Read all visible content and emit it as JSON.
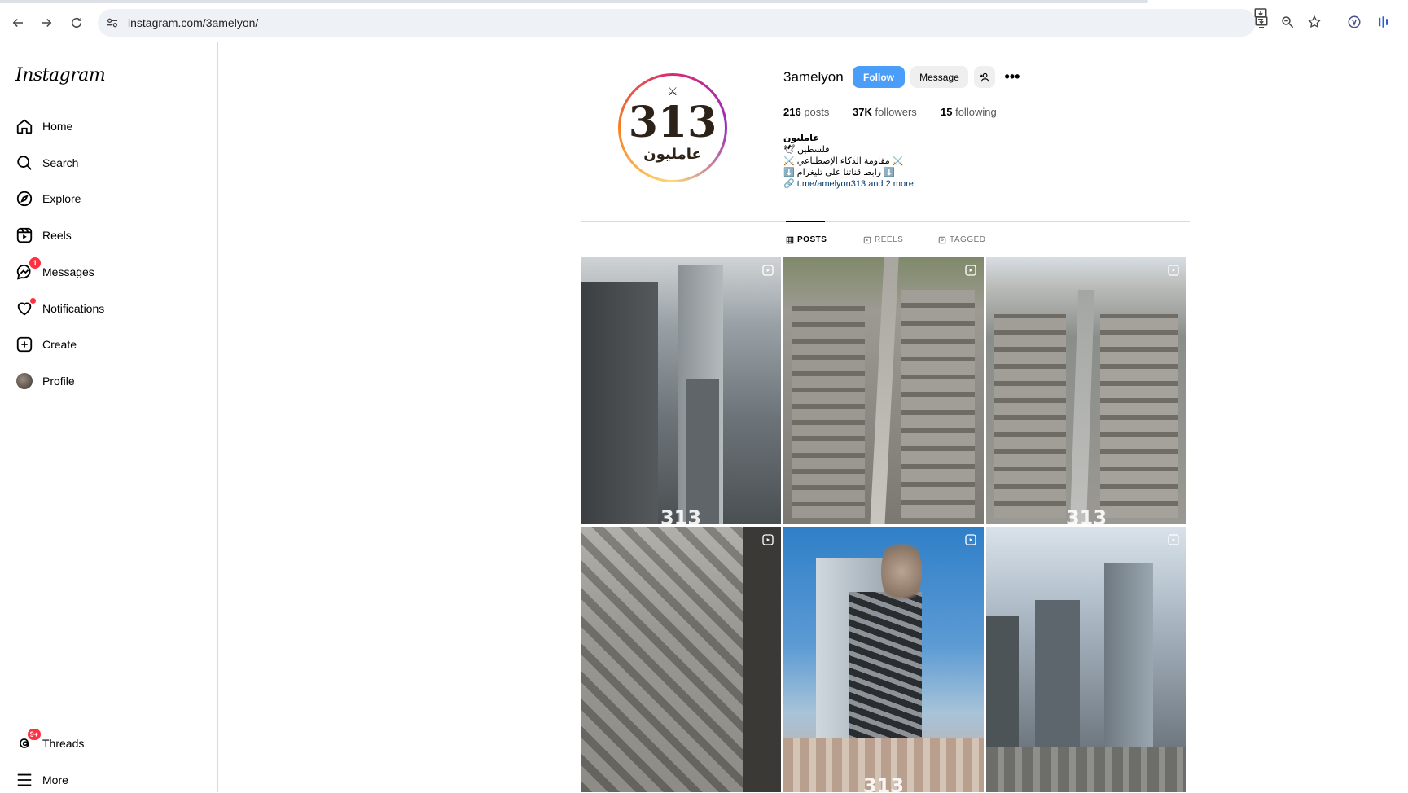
{
  "browser": {
    "url": "instagram.com/3amelyon/"
  },
  "sidebar": {
    "logo": "Instagram",
    "items": [
      {
        "label": "Home"
      },
      {
        "label": "Search"
      },
      {
        "label": "Explore"
      },
      {
        "label": "Reels"
      },
      {
        "label": "Messages",
        "badge": "1"
      },
      {
        "label": "Notifications"
      },
      {
        "label": "Create"
      },
      {
        "label": "Profile"
      }
    ],
    "bottom": [
      {
        "label": "Threads",
        "badge": "9+"
      },
      {
        "label": "More"
      }
    ]
  },
  "profile": {
    "avatar_number": "313",
    "avatar_arabic": "عامليون",
    "username": "3amelyon",
    "follow_label": "Follow",
    "message_label": "Message",
    "stats": {
      "posts_count": "216",
      "posts_label": "posts",
      "followers_count": "37K",
      "followers_label": "followers",
      "following_count": "15",
      "following_label": "following"
    },
    "bio": {
      "name": "عامليون",
      "line1": "🕊 فلسطين",
      "line2": "⚔️ مقاومة الذكاء الإصطناعي ⚔️",
      "line3": "⬇️ رابط قناتنا على تليغرام ⬇️",
      "link": "t.me/amelyon313 and 2 more"
    }
  },
  "tabs": [
    {
      "label": "POSTS",
      "active": true
    },
    {
      "label": "REELS",
      "active": false
    },
    {
      "label": "TAGGED",
      "active": false
    }
  ],
  "posts": {
    "watermark": "313"
  }
}
